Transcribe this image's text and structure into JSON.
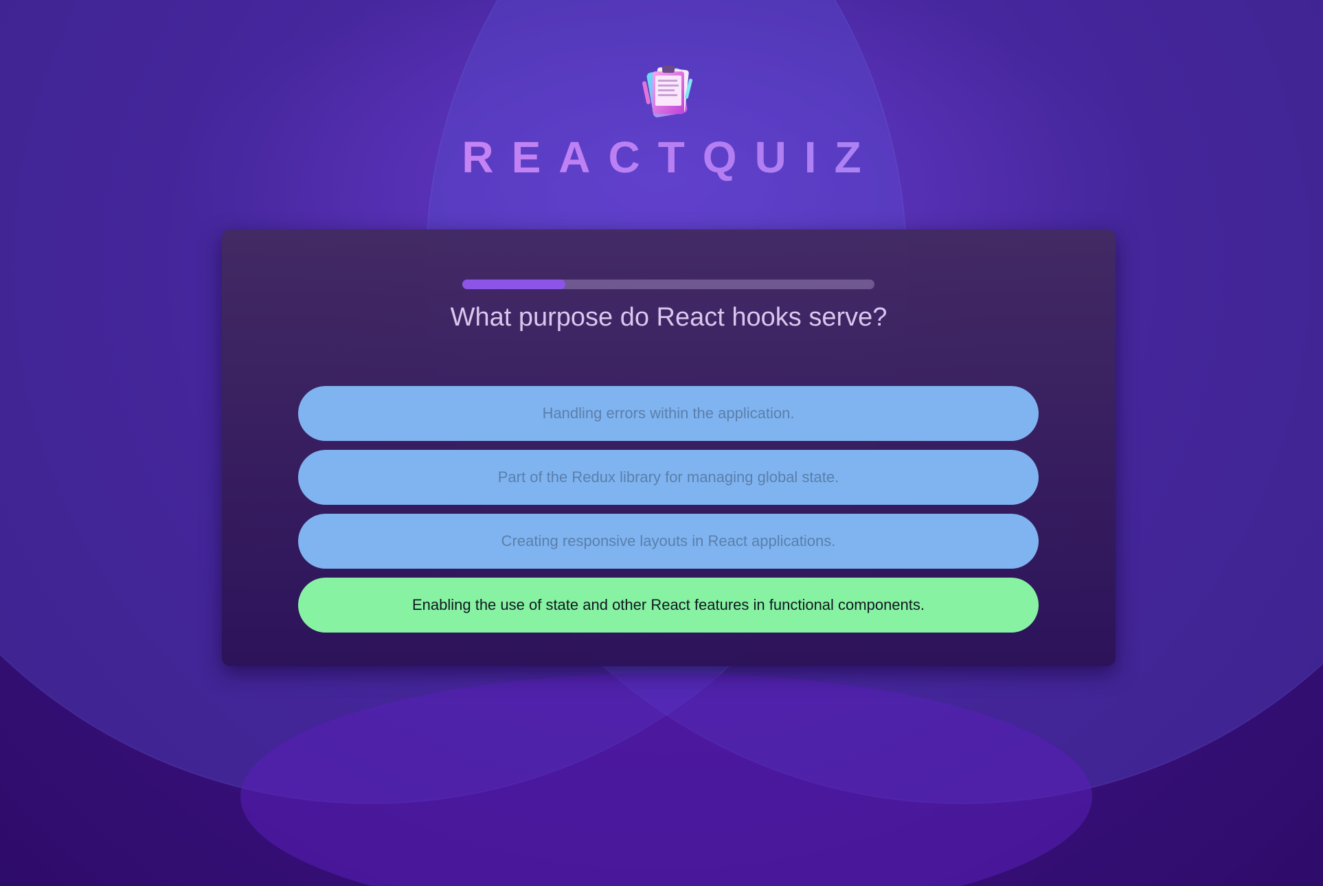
{
  "app": {
    "brand_title": "REACTQUIZ",
    "logo_icon": "clipboard-quiz-icon"
  },
  "quiz": {
    "progress": 0.25,
    "question": "What purpose do React hooks serve?",
    "options": [
      {
        "label": "Handling errors within the application.",
        "state": "neutral"
      },
      {
        "label": "Part of the Redux library for managing global state.",
        "state": "neutral"
      },
      {
        "label": "Creating responsive layouts in React applications.",
        "state": "neutral"
      },
      {
        "label": "Enabling the use of state and other React features in functional components.",
        "state": "correct"
      }
    ]
  },
  "colors": {
    "background": "#3d1282",
    "card": "#3a2060",
    "progress_fill": "#8c55e8",
    "option_neutral": "#80b4f0",
    "option_correct": "#86f2a2",
    "brand_gradient_start": "#e58cf2",
    "brand_gradient_end": "#8f8ff5"
  }
}
